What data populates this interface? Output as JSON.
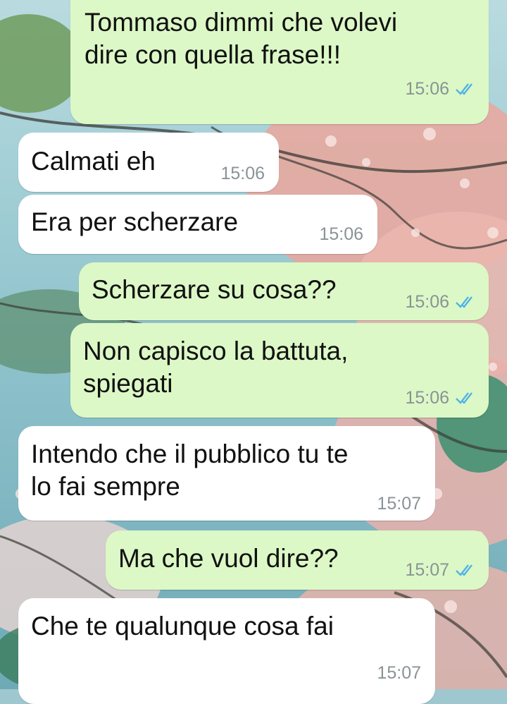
{
  "chat": {
    "messages": [
      {
        "direction": "outgoing",
        "text": "Tommaso dimmi che volevi\ndire con quella frase!!!",
        "time": "15:06",
        "status": "read"
      },
      {
        "direction": "incoming",
        "text": "Calmati eh",
        "time": "15:06"
      },
      {
        "direction": "incoming",
        "text": "Era per scherzare",
        "time": "15:06"
      },
      {
        "direction": "outgoing",
        "text": "Scherzare su cosa??",
        "time": "15:06",
        "status": "read"
      },
      {
        "direction": "outgoing",
        "text": "Non capisco la battuta,\nspiegati",
        "time": "15:06",
        "status": "read"
      },
      {
        "direction": "incoming",
        "text": "Intendo che il pubblico tu te\nlo fai sempre",
        "time": "15:07"
      },
      {
        "direction": "outgoing",
        "text": "Ma che vuol dire??",
        "time": "15:07",
        "status": "read"
      },
      {
        "direction": "incoming",
        "text": "Che te qualunque cosa fai",
        "time": "15:07"
      }
    ]
  },
  "colors": {
    "outgoing_bubble": "#dcf8c6",
    "incoming_bubble": "#ffffff",
    "read_ticks": "#4fb3e8",
    "timestamp": "#8a9396"
  },
  "icons": {
    "read_receipt": "double-check-icon"
  }
}
